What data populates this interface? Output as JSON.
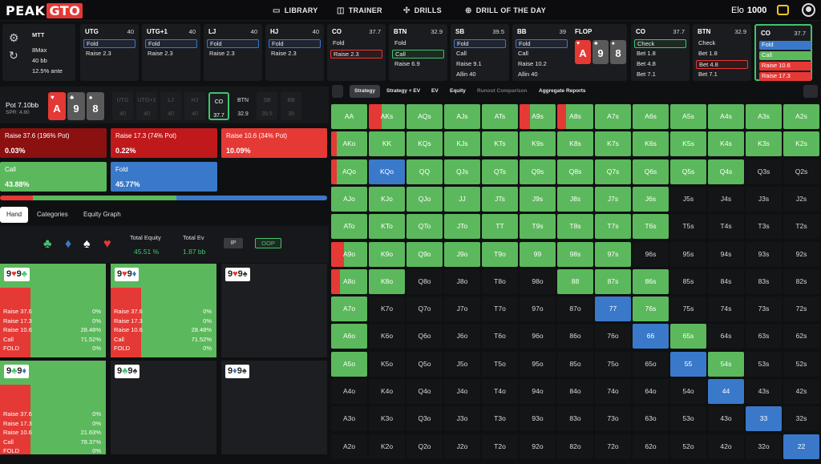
{
  "brand": {
    "name": "PEAK",
    "accent": "GTO"
  },
  "nav": [
    {
      "label": "LIBRARY",
      "icon": "library-icon"
    },
    {
      "label": "TRAINER",
      "icon": "gamepad-icon"
    },
    {
      "label": "DRILLS",
      "icon": "target-icon"
    },
    {
      "label": "DRILL OF THE DAY",
      "icon": "plus-circle-icon"
    }
  ],
  "elo": {
    "label": "Elo",
    "value": "1000"
  },
  "context": {
    "game": "MTT",
    "format": "8Max",
    "stack": "40 bb",
    "ante": "12.5% ante"
  },
  "positions": [
    {
      "name": "UTG",
      "stack": "40",
      "actions": [
        {
          "t": "Fold",
          "s": "hb"
        },
        {
          "t": "Raise 2.3",
          "s": ""
        }
      ]
    },
    {
      "name": "UTG+1",
      "stack": "40",
      "actions": [
        {
          "t": "Fold",
          "s": "hb"
        },
        {
          "t": "Raise 2.3",
          "s": ""
        }
      ]
    },
    {
      "name": "LJ",
      "stack": "40",
      "actions": [
        {
          "t": "Fold",
          "s": "hb"
        },
        {
          "t": "Raise 2.3",
          "s": ""
        }
      ]
    },
    {
      "name": "HJ",
      "stack": "40",
      "actions": [
        {
          "t": "Fold",
          "s": "hb"
        },
        {
          "t": "Raise 2.3",
          "s": ""
        }
      ]
    },
    {
      "name": "CO",
      "stack": "37.7",
      "actions": [
        {
          "t": "Fold",
          "s": ""
        },
        {
          "t": "Raise 2.3",
          "s": "hr"
        }
      ]
    },
    {
      "name": "BTN",
      "stack": "32.9",
      "actions": [
        {
          "t": "Fold",
          "s": ""
        },
        {
          "t": "Call",
          "s": "hg"
        },
        {
          "t": "Raise 6.9",
          "s": ""
        }
      ]
    },
    {
      "name": "SB",
      "stack": "39.5",
      "actions": [
        {
          "t": "Fold",
          "s": "hb"
        },
        {
          "t": "Call",
          "s": ""
        },
        {
          "t": "Raise 9.1",
          "s": ""
        },
        {
          "t": "Allin 40",
          "s": ""
        }
      ]
    },
    {
      "name": "BB",
      "stack": "39",
      "actions": [
        {
          "t": "Fold",
          "s": "hb"
        },
        {
          "t": "Call",
          "s": ""
        },
        {
          "t": "Raise 10.2",
          "s": ""
        },
        {
          "t": "Allin 40",
          "s": ""
        }
      ]
    }
  ],
  "flop": {
    "label": "FLOP",
    "cards": [
      {
        "rank": "A",
        "suit": "♥",
        "color": "#e53935"
      },
      {
        "rank": "9",
        "suit": "♣",
        "color": "#5a5a5a"
      },
      {
        "rank": "8",
        "suit": "♠",
        "color": "#5a5a5a"
      }
    ]
  },
  "postflop": [
    {
      "name": "CO",
      "stack": "37.7",
      "actions": [
        {
          "t": "Check",
          "s": "hg"
        },
        {
          "t": "Bet 1.8",
          "s": ""
        },
        {
          "t": "Bet 4.8",
          "s": ""
        },
        {
          "t": "Bet 7.1",
          "s": ""
        }
      ]
    },
    {
      "name": "BTN",
      "stack": "32.9",
      "actions": [
        {
          "t": "Check",
          "s": ""
        },
        {
          "t": "Bet 1.8",
          "s": ""
        },
        {
          "t": "Bet 4.8",
          "s": "hr"
        },
        {
          "t": "Bet 7.1",
          "s": ""
        }
      ]
    },
    {
      "name": "CO",
      "stack": "37.7",
      "actions": [
        {
          "t": "Fold",
          "s": "fb"
        },
        {
          "t": "Call",
          "s": "fg"
        },
        {
          "t": "Raise 10.6",
          "s": "fr"
        },
        {
          "t": "Raise 17.3",
          "s": "fr"
        }
      ]
    }
  ],
  "pot": {
    "label": "Pot",
    "value": "7.10bb",
    "spr": "SPR: 4.80"
  },
  "board": [
    {
      "rank": "A",
      "suit": "♥",
      "color": "#e53935"
    },
    {
      "rank": "9",
      "suit": "♣",
      "color": "#5a5a5a"
    },
    {
      "rank": "8",
      "suit": "♠",
      "color": "#5a5a5a"
    }
  ],
  "seats": [
    {
      "name": "UTG",
      "stack": "40",
      "style": ""
    },
    {
      "name": "UTG+1",
      "stack": "40",
      "style": ""
    },
    {
      "name": "LJ",
      "stack": "40",
      "style": ""
    },
    {
      "name": "HJ",
      "stack": "40",
      "style": ""
    },
    {
      "name": "CO",
      "stack": "37.7",
      "style": "active"
    },
    {
      "name": "BTN",
      "stack": "32.9",
      "style": "dark"
    },
    {
      "name": "SB",
      "stack": "39.5",
      "style": ""
    },
    {
      "name": "BB",
      "stack": "39",
      "style": ""
    }
  ],
  "strategy": [
    {
      "label": "Raise 37.6 (196% Pot)",
      "pct": "0.03%",
      "color": "#8b1010"
    },
    {
      "label": "Raise 17.3 (74% Pot)",
      "pct": "0.22%",
      "color": "#c0191b"
    },
    {
      "label": "Raise 10.6 (34% Pot)",
      "pct": "10.09%",
      "color": "#e53935"
    },
    {
      "label": "Call",
      "pct": "43.88%",
      "color": "#5cb85c"
    },
    {
      "label": "Fold",
      "pct": "45.77%",
      "color": "#3a79c9"
    }
  ],
  "mix": [
    {
      "pct": 10,
      "color": "#e53935"
    },
    {
      "pct": 44,
      "color": "#5cb85c"
    },
    {
      "pct": 46,
      "color": "#3a79c9"
    }
  ],
  "tabs": [
    "Hand",
    "Categories",
    "Equity Graph"
  ],
  "equity": {
    "suits": [
      {
        "s": "♣",
        "c": "#3ec46d"
      },
      {
        "s": "♦",
        "c": "#3a79c9"
      },
      {
        "s": "♠",
        "c": "#ffffff"
      },
      {
        "s": "♥",
        "c": "#e53935"
      }
    ],
    "total_equity_label": "Total Equity",
    "total_equity": "45.51 %",
    "total_ev_label": "Total Ev",
    "total_ev": "1.87 bb",
    "ip": "IP",
    "oop": "OOP"
  },
  "hands": [
    {
      "cards": [
        {
          "r": "9",
          "s": "♥",
          "c": "#e53935"
        },
        {
          "r": "9",
          "s": "♣",
          "c": "#3ec46d"
        }
      ],
      "filled": true,
      "green": 0.72,
      "rows": [
        [
          "Raise 37.6",
          "0%"
        ],
        [
          "Raise 17.3",
          "0%"
        ],
        [
          "Raise 10.6",
          "28.48%"
        ],
        [
          "Call",
          "71.52%"
        ],
        [
          "FOLD",
          "0%"
        ]
      ]
    },
    {
      "cards": [
        {
          "r": "9",
          "s": "♥",
          "c": "#e53935"
        },
        {
          "r": "9",
          "s": "♦",
          "c": "#3a79c9"
        }
      ],
      "filled": true,
      "green": 0.72,
      "rows": [
        [
          "Raise 37.6",
          "0%"
        ],
        [
          "Raise 17.3",
          "0%"
        ],
        [
          "Raise 10.6",
          "28.48%"
        ],
        [
          "Call",
          "71.52%"
        ],
        [
          "FOLD",
          "0%"
        ]
      ]
    },
    {
      "cards": [
        {
          "r": "9",
          "s": "♥",
          "c": "#e53935"
        },
        {
          "r": "9",
          "s": "♠",
          "c": "#333333"
        }
      ],
      "filled": false,
      "green": 0,
      "rows": []
    },
    {
      "cards": [
        {
          "r": "9",
          "s": "♣",
          "c": "#3ec46d"
        },
        {
          "r": "9",
          "s": "♦",
          "c": "#3a79c9"
        }
      ],
      "filled": true,
      "green": 0.78,
      "rows": [
        [
          "Raise 37.6",
          "0%"
        ],
        [
          "Raise 17.3",
          "0%"
        ],
        [
          "Raise 10.6",
          "21.63%"
        ],
        [
          "Call",
          "78.37%"
        ],
        [
          "FOLD",
          "0%"
        ]
      ]
    },
    {
      "cards": [
        {
          "r": "9",
          "s": "♣",
          "c": "#3ec46d"
        },
        {
          "r": "9",
          "s": "♠",
          "c": "#333333"
        }
      ],
      "filled": false,
      "green": 0,
      "rows": []
    },
    {
      "cards": [
        {
          "r": "9",
          "s": "♦",
          "c": "#3a79c9"
        },
        {
          "r": "9",
          "s": "♠",
          "c": "#333333"
        }
      ],
      "filled": false,
      "green": 0,
      "rows": []
    }
  ],
  "rtabs": [
    {
      "label": "Strategy",
      "style": "on"
    },
    {
      "label": "Strategy + EV",
      "style": ""
    },
    {
      "label": "EV",
      "style": ""
    },
    {
      "label": "Equity",
      "style": ""
    },
    {
      "label": "Runout Comparison",
      "style": "dim"
    },
    {
      "label": "Aggregate Reports",
      "style": ""
    }
  ],
  "colors": {
    "raise": "#e53935",
    "call": "#5cb85c",
    "fold": "#3a79c9",
    "empty": "#141517"
  },
  "grid": {
    "ranks": [
      "A",
      "K",
      "Q",
      "J",
      "T",
      "9",
      "8",
      "7",
      "6",
      "5",
      "4",
      "3",
      "2"
    ],
    "mix": [
      [
        "g",
        "r9g",
        "g",
        "g",
        "g",
        "r7g",
        "r6g",
        "g",
        "g",
        "g",
        "g",
        "g",
        "g"
      ],
      [
        "r4g",
        "g",
        "g",
        "g",
        "g",
        "g",
        "g",
        "g",
        "g",
        "g",
        "g",
        "g",
        "g"
      ],
      [
        "r4g",
        "b",
        "g",
        "g",
        "g",
        "g",
        "g",
        "g",
        "g",
        "g",
        "g",
        "x",
        "x"
      ],
      [
        "g",
        "g",
        "g",
        "g",
        "g",
        "g",
        "g",
        "g",
        "g",
        "x",
        "x",
        "x",
        "x"
      ],
      [
        "g",
        "g",
        "g",
        "g",
        "g",
        "g",
        "g",
        "g",
        "g",
        "x",
        "x",
        "x",
        "x"
      ],
      [
        "r9g",
        "g",
        "g",
        "g",
        "g",
        "g",
        "g",
        "g",
        "x",
        "x",
        "x",
        "x",
        "x"
      ],
      [
        "r6g",
        "g",
        "x",
        "x",
        "x",
        "x",
        "g",
        "g",
        "g",
        "x",
        "x",
        "x",
        "x"
      ],
      [
        "g",
        "x",
        "x",
        "x",
        "x",
        "x",
        "x",
        "b",
        "g",
        "x",
        "x",
        "x",
        "x"
      ],
      [
        "g",
        "x",
        "x",
        "x",
        "x",
        "x",
        "x",
        "x",
        "b",
        "g",
        "x",
        "x",
        "x"
      ],
      [
        "g",
        "x",
        "x",
        "x",
        "x",
        "x",
        "x",
        "x",
        "x",
        "b",
        "g",
        "x",
        "x"
      ],
      [
        "x",
        "x",
        "x",
        "x",
        "x",
        "x",
        "x",
        "x",
        "x",
        "x",
        "b",
        "x",
        "x"
      ],
      [
        "x",
        "x",
        "x",
        "x",
        "x",
        "x",
        "x",
        "x",
        "x",
        "x",
        "x",
        "b",
        "x"
      ],
      [
        "x",
        "x",
        "x",
        "x",
        "x",
        "x",
        "x",
        "x",
        "x",
        "x",
        "x",
        "x",
        "b"
      ]
    ]
  }
}
